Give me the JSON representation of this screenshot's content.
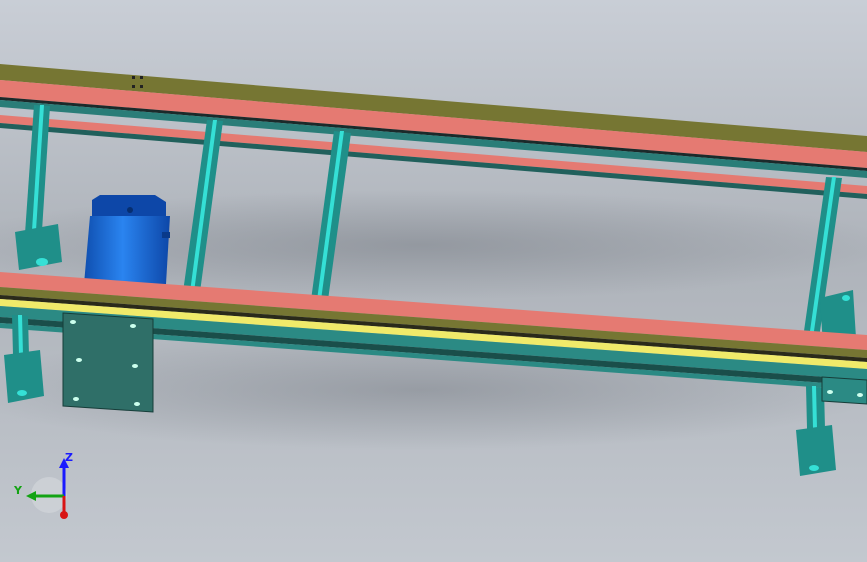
{
  "viewport": {
    "background": {
      "top": "#c9ced6",
      "mid": "#aeb3ba",
      "bottom": "#c3c8cf"
    }
  },
  "model": {
    "frame_color": "#767633",
    "rail_color": "#e57a72",
    "support_color": "#1f8f89",
    "support_highlight": "#35e0d6",
    "motor_color": "#1e6fd8",
    "guide_strip_color": "#f0ea6a",
    "mount_plate_color": "#2f6f68"
  },
  "triad": {
    "z_label": "Z",
    "y_label": "Y",
    "z_color": "#1a1aff",
    "y_color": "#13a313",
    "x_color": "#d81414"
  }
}
